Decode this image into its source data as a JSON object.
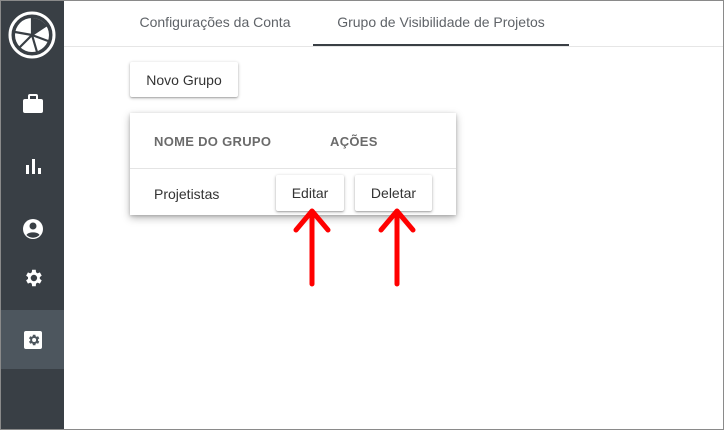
{
  "sidebar": {
    "items": [
      {
        "icon": "briefcase-icon"
      },
      {
        "icon": "bar-chart-icon"
      },
      {
        "icon": "account-circle-icon"
      },
      {
        "icon": "gear-icon"
      },
      {
        "icon": "settings-applications-icon",
        "active": true
      }
    ]
  },
  "tabs": [
    {
      "label": "Configurações da Conta",
      "active": false
    },
    {
      "label": "Grupo de Visibilidade de Projetos",
      "active": true
    }
  ],
  "toolbar": {
    "new_group_label": "Novo Grupo"
  },
  "table": {
    "headers": [
      "NOME DO GRUPO",
      "AÇÕES"
    ],
    "rows": [
      {
        "name": "Projetistas",
        "edit_label": "Editar",
        "delete_label": "Deletar"
      }
    ]
  },
  "annotations": {
    "arrow_color": "#ff0000"
  },
  "colors": {
    "sidebar": "#393f45",
    "sidebar_active": "#4d565e",
    "tab_underline": "#3a3f45"
  }
}
